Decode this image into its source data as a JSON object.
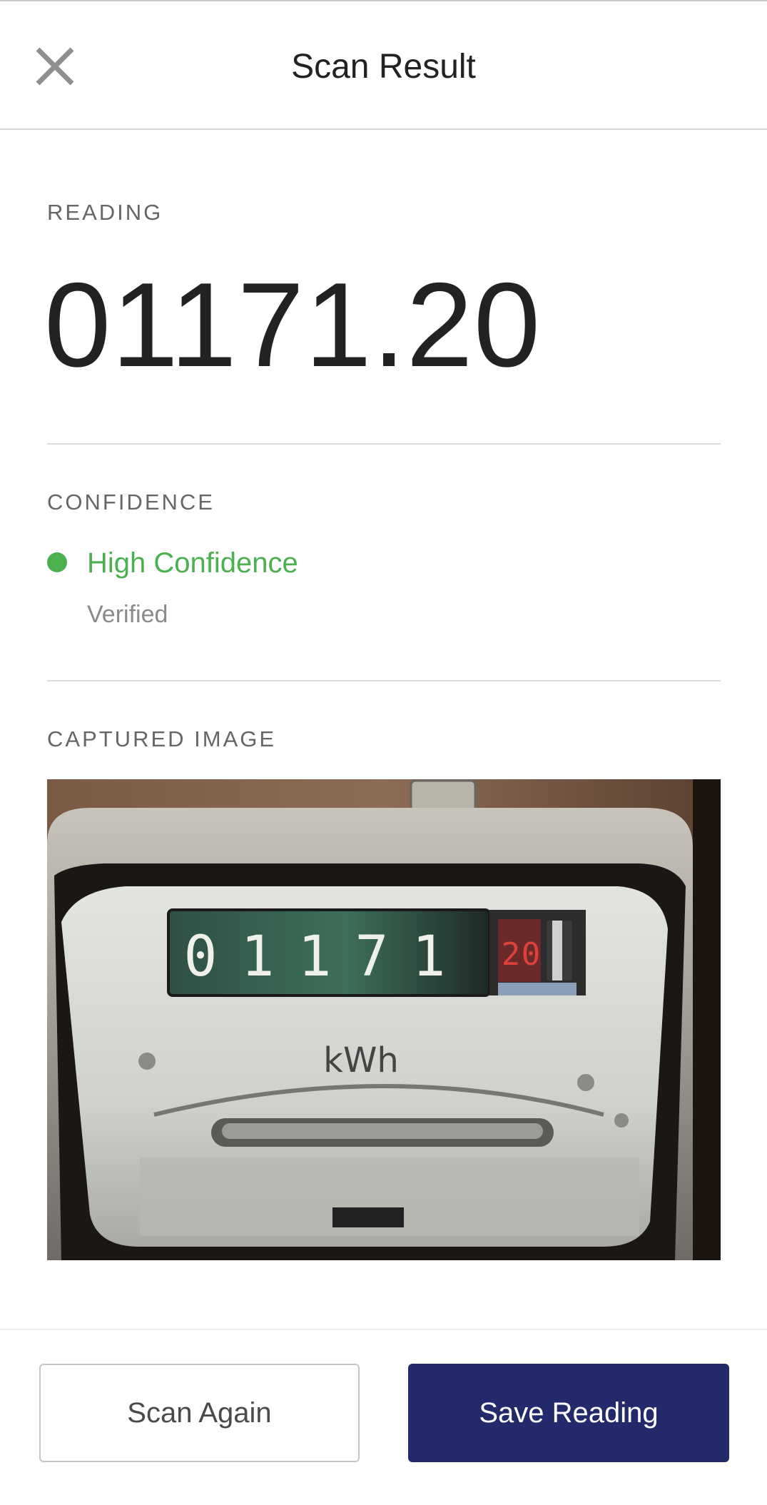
{
  "header": {
    "title": "Scan Result",
    "close_icon": "close-icon"
  },
  "reading": {
    "label": "READING",
    "value": "01171.20"
  },
  "confidence": {
    "label": "CONFIDENCE",
    "level": "High Confidence",
    "status": "Verified",
    "color": "#4caf50"
  },
  "captured_image": {
    "label": "CAPTURED IMAGE",
    "meter_counter_digits": [
      "0",
      "1",
      "1",
      "7",
      "1"
    ],
    "meter_decimal_digits": [
      "2",
      "0"
    ],
    "meter_unit": "kWh"
  },
  "actions": {
    "scan_again_label": "Scan Again",
    "save_label": "Save Reading",
    "primary_color": "#232a6b"
  }
}
